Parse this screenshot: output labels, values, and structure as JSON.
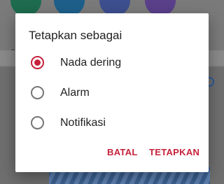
{
  "dialog": {
    "title": "Tetapkan sebagai",
    "options": [
      {
        "label": "Nada dering",
        "selected": true
      },
      {
        "label": "Alarm",
        "selected": false
      },
      {
        "label": "Notifikasi",
        "selected": false
      }
    ],
    "cancel_label": "BATAL",
    "confirm_label": "TETAPKAN"
  },
  "colors": {
    "accent": "#c6213b",
    "scrim": "#7a7a7a"
  },
  "background": {
    "icon_colors": [
      "#1e6b4f",
      "#1d5f8a",
      "#3e4f8f",
      "#5a3f8a"
    ]
  }
}
